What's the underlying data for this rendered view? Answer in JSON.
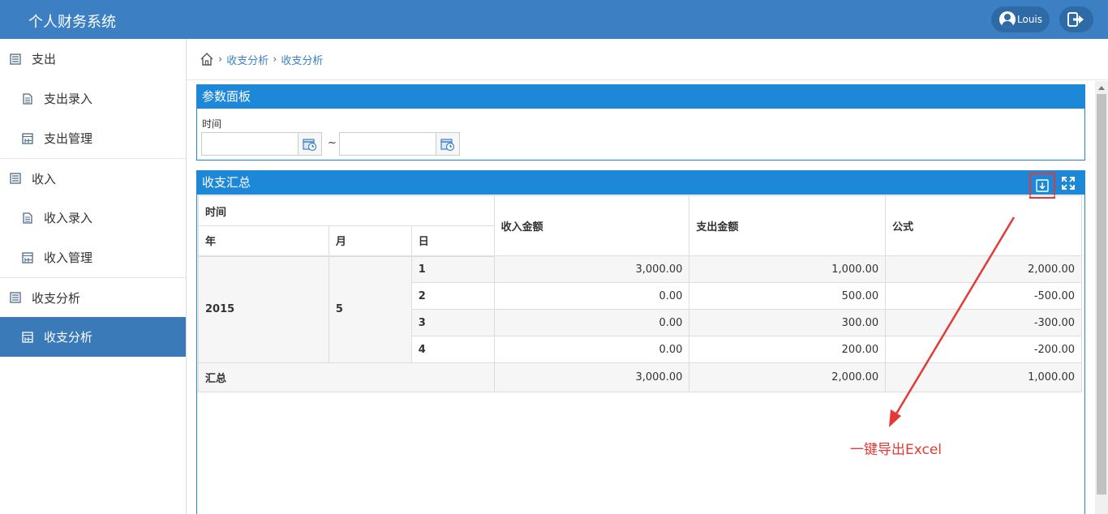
{
  "app": {
    "title": "个人财务系统"
  },
  "user": {
    "name": "Louis"
  },
  "sidebar": {
    "items": [
      {
        "label": "支出",
        "type": "group"
      },
      {
        "label": "支出录入",
        "type": "sub"
      },
      {
        "label": "支出管理",
        "type": "sub"
      },
      {
        "label": "收入",
        "type": "group"
      },
      {
        "label": "收入录入",
        "type": "sub"
      },
      {
        "label": "收入管理",
        "type": "sub"
      },
      {
        "label": "收支分析",
        "type": "group"
      },
      {
        "label": "收支分析",
        "type": "sub",
        "active": true
      }
    ]
  },
  "breadcrumb": {
    "items": [
      "收支分析",
      "收支分析"
    ]
  },
  "param_panel": {
    "title": "参数面板",
    "time_label": "时间",
    "separator": "~",
    "start_date": "",
    "end_date": ""
  },
  "summary_panel": {
    "title": "收支汇总",
    "headers": {
      "time": "时间",
      "year": "年",
      "month": "月",
      "day": "日",
      "income": "收入金额",
      "expense": "支出金额",
      "formula": "公式"
    },
    "year": "2015",
    "month": "5",
    "rows": [
      {
        "day": "1",
        "income": "3,000.00",
        "expense": "1,000.00",
        "formula": "2,000.00"
      },
      {
        "day": "2",
        "income": "0.00",
        "expense": "500.00",
        "formula": "-500.00"
      },
      {
        "day": "3",
        "income": "0.00",
        "expense": "300.00",
        "formula": "-300.00"
      },
      {
        "day": "4",
        "income": "0.00",
        "expense": "200.00",
        "formula": "-200.00"
      }
    ],
    "total": {
      "label": "汇总",
      "income": "3,000.00",
      "expense": "2,000.00",
      "formula": "1,000.00"
    }
  },
  "annotation": {
    "text": "一键导出Excel"
  },
  "colors": {
    "header": "#3c80c3",
    "panel": "#1e88d8",
    "active": "#3a7ab8",
    "annotation": "#e53935"
  }
}
